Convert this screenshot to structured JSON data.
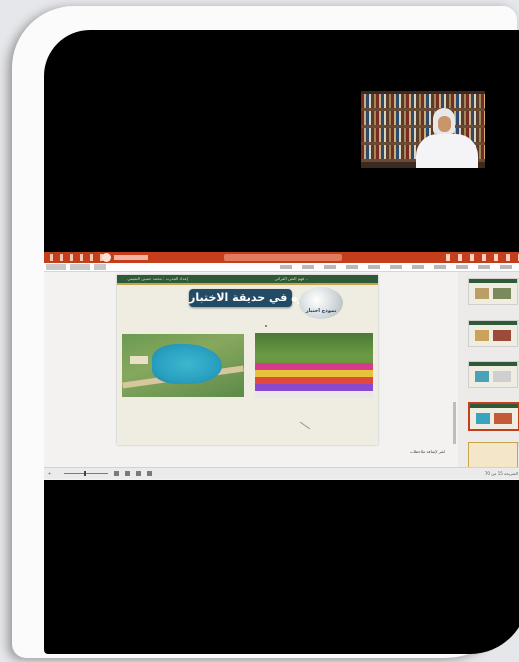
{
  "slide": {
    "title": "تنزه في حديقة الاختبار",
    "header_text": "فهم النص القرائي ..",
    "teacher": "إعداد المدرب : محمد حسين التميمي",
    "badge_label": "نموذج اختبار"
  },
  "app": {
    "notes_placeholder": "انقر لإضافة ملاحظات",
    "zoom_label": "+",
    "status_right": "الشريحة 15 من 70"
  },
  "thumbnails": {
    "numbers": [
      "12",
      "13",
      "14",
      "15",
      "16"
    ]
  },
  "colors": {
    "titlebar": "#c43e1c",
    "slide_header": "#2e5a37",
    "title_bg": "#234b66"
  }
}
